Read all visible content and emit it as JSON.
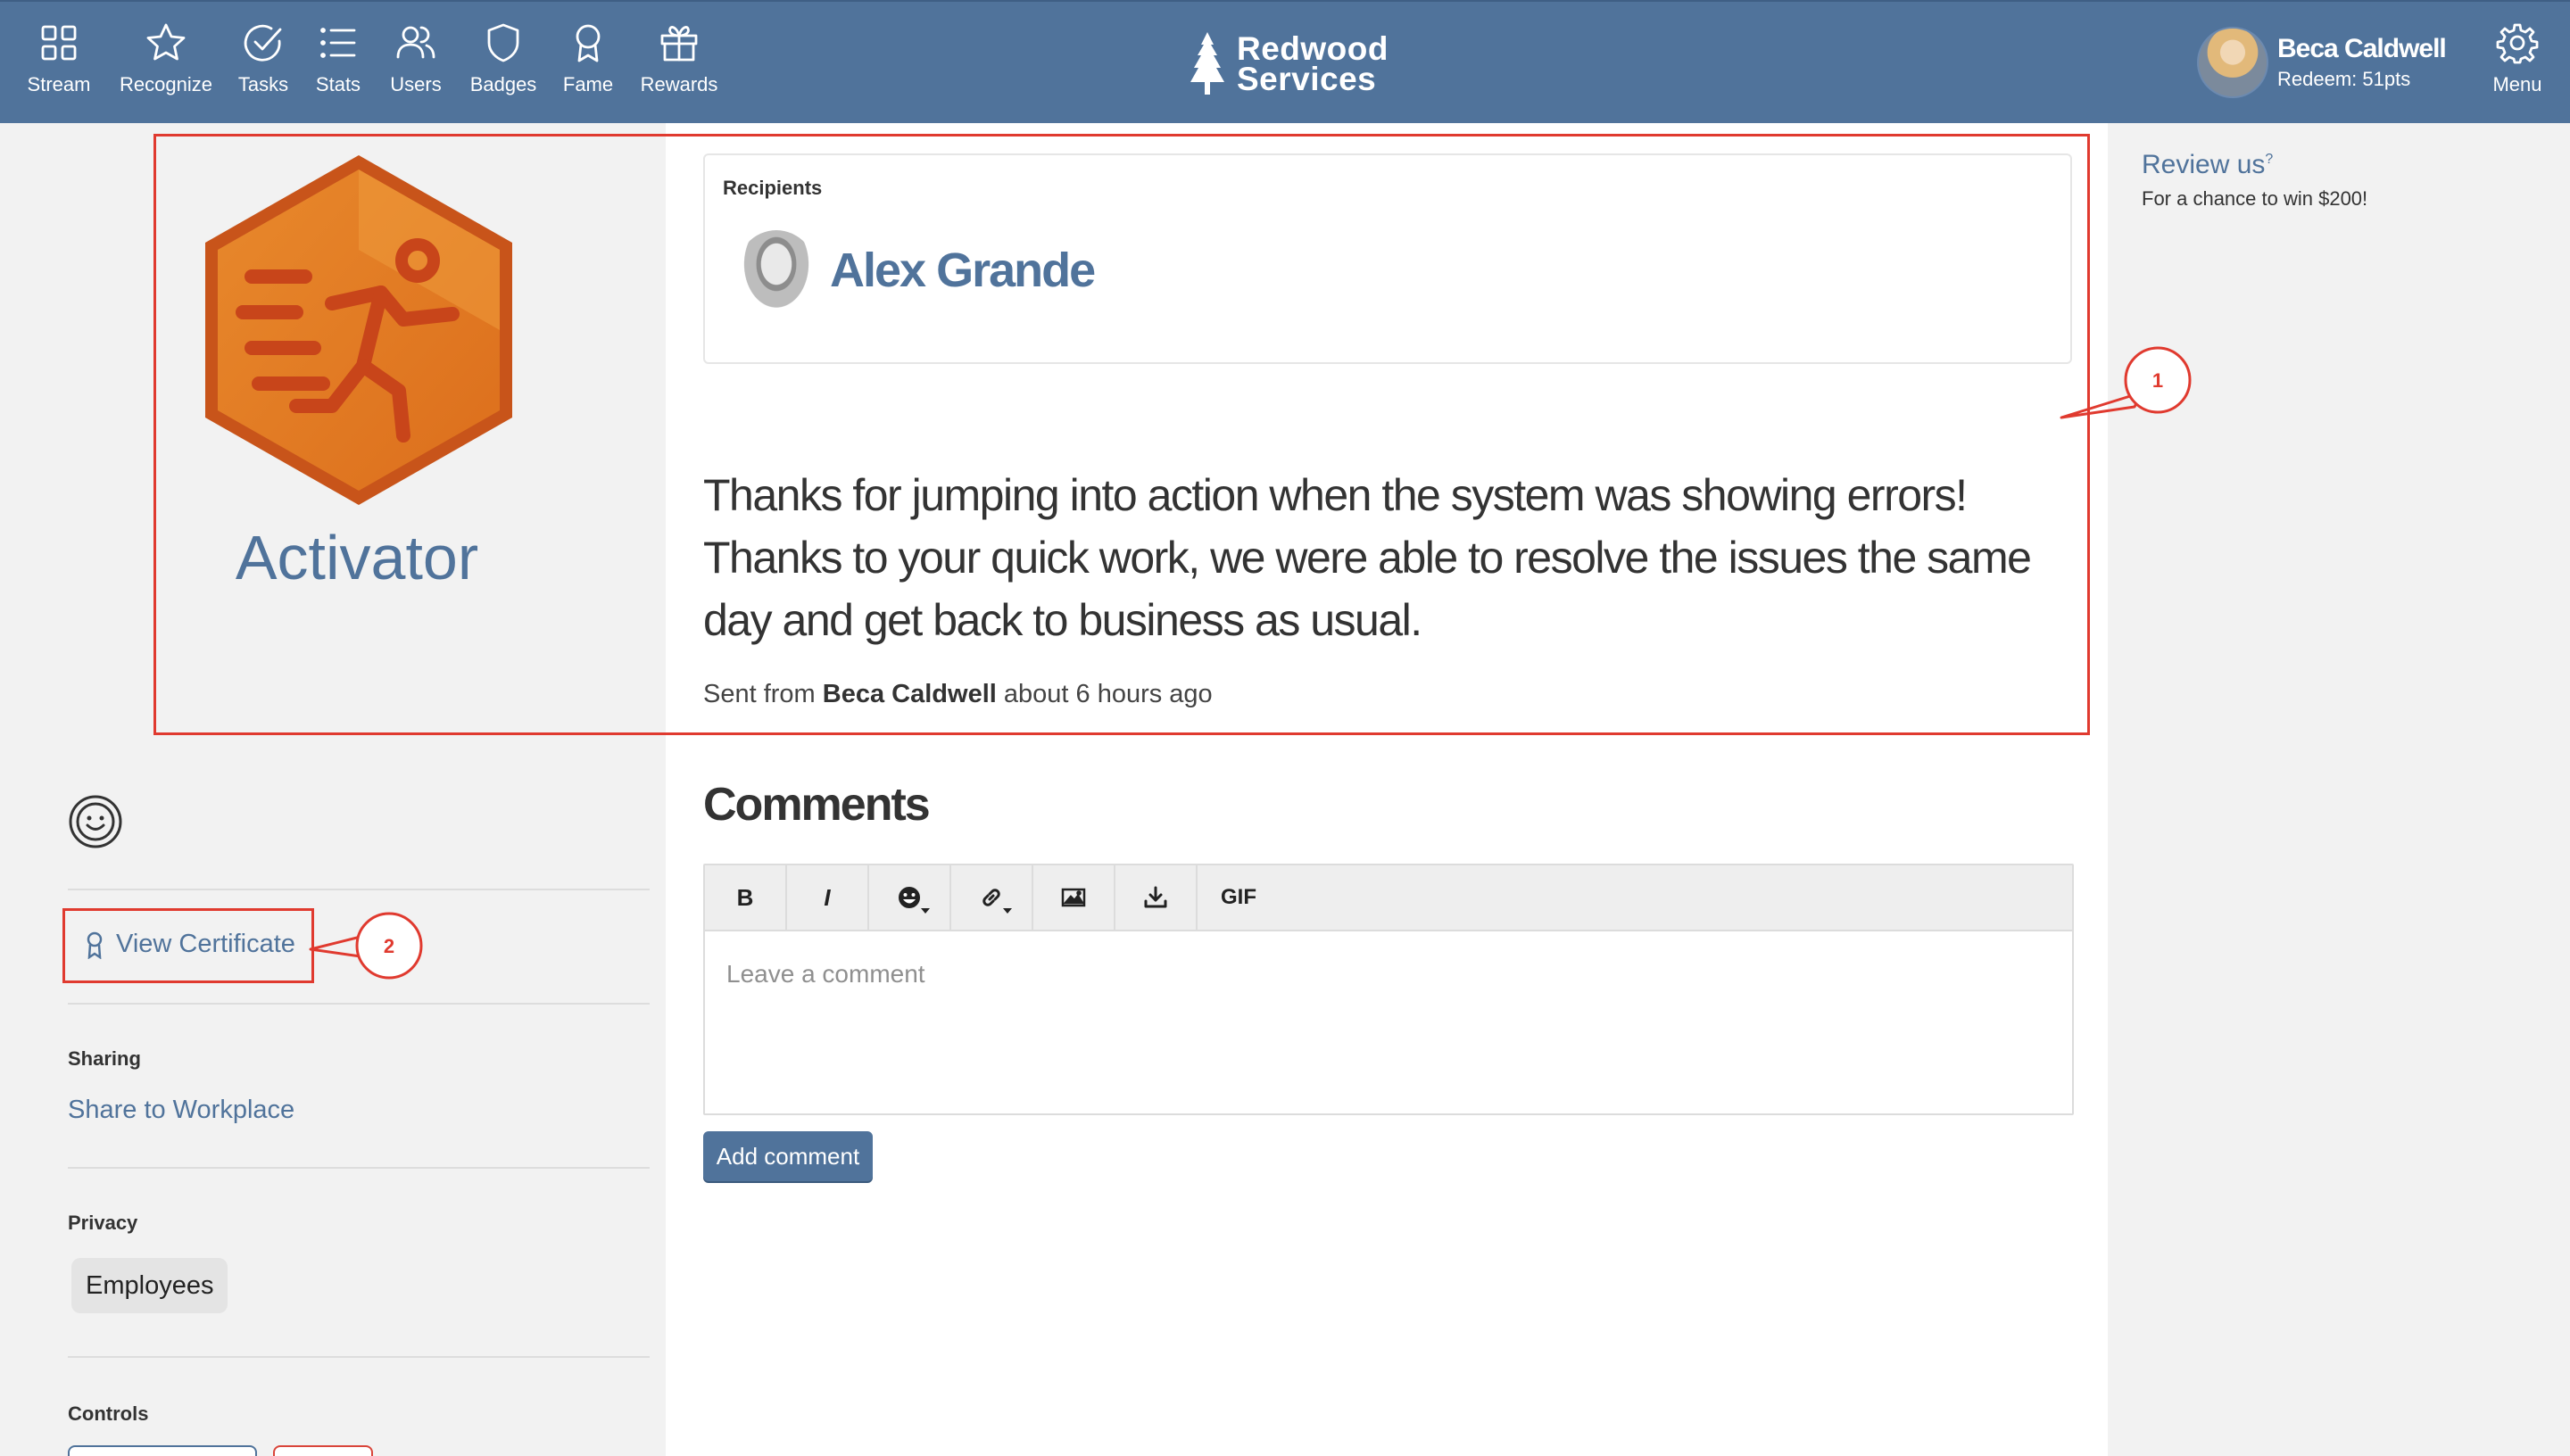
{
  "nav": {
    "items": [
      {
        "label": "Stream",
        "icon": "grid-icon"
      },
      {
        "label": "Recognize",
        "icon": "star-icon"
      },
      {
        "label": "Tasks",
        "icon": "check-circle-icon"
      },
      {
        "label": "Stats",
        "icon": "list-icon"
      },
      {
        "label": "Users",
        "icon": "users-icon"
      },
      {
        "label": "Badges",
        "icon": "shield-icon"
      },
      {
        "label": "Fame",
        "icon": "ribbon-icon"
      },
      {
        "label": "Rewards",
        "icon": "gift-icon"
      }
    ],
    "menu_label": "Menu"
  },
  "brand": {
    "line1": "Redwood",
    "line2": "Services"
  },
  "user": {
    "name": "Beca Caldwell",
    "redeem": "Redeem: 51pts"
  },
  "badge": {
    "name": "Activator",
    "color": "#e07a24"
  },
  "recipients": {
    "label": "Recipients",
    "names": [
      "Alex Grande"
    ]
  },
  "message": {
    "text": "Thanks for jumping into action when the system was showing errors! Thanks to your quick work, we were able to resolve the issues the same day and get back to business as usual.",
    "sent_prefix": "Sent from",
    "sender": "Beca Caldwell",
    "time": "about 6 hours ago"
  },
  "sidebar": {
    "view_certificate": "View Certificate",
    "sharing_label": "Sharing",
    "share_link": "Share to Workplace",
    "privacy_label": "Privacy",
    "privacy_value": "Employees",
    "controls_label": "Controls"
  },
  "comments": {
    "title": "Comments",
    "toolbar": {
      "bold": "B",
      "italic": "I",
      "gif": "GIF"
    },
    "placeholder": "Leave a comment",
    "submit": "Add comment"
  },
  "review": {
    "title": "Review us",
    "sup": "?",
    "subtitle": "For a chance to win $200!"
  },
  "annotations": {
    "one": "1",
    "two": "2",
    "color": "#e03a2f"
  },
  "colors": {
    "header": "#50739b",
    "link": "#50739b",
    "badge": "#e07a24"
  }
}
